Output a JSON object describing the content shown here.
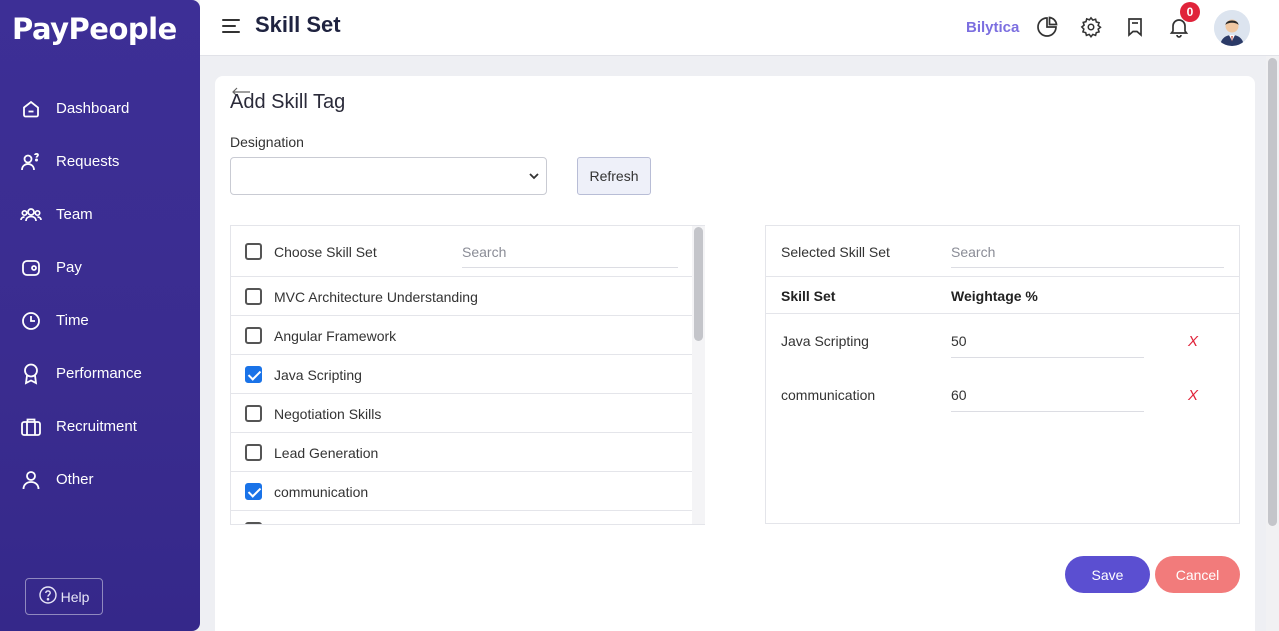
{
  "sidebar": {
    "logo": "PayPeople",
    "items": [
      {
        "label": "Dashboard",
        "icon": "home-icon"
      },
      {
        "label": "Requests",
        "icon": "user-question-icon"
      },
      {
        "label": "Team",
        "icon": "team-icon"
      },
      {
        "label": "Pay",
        "icon": "wallet-icon"
      },
      {
        "label": "Time",
        "icon": "clock-icon"
      },
      {
        "label": "Performance",
        "icon": "award-icon"
      },
      {
        "label": "Recruitment",
        "icon": "briefcase-icon"
      },
      {
        "label": "Other",
        "icon": "person-icon"
      }
    ],
    "help_label": "Help"
  },
  "header": {
    "title": "Skill Set",
    "brand_link": "Bilytica",
    "notification_count": "0"
  },
  "form": {
    "title": "Add Skill Tag",
    "designation_label": "Designation",
    "designation_value": "",
    "refresh_label": "Refresh"
  },
  "skill_list": {
    "header_label": "Choose Skill Set",
    "search_placeholder": "Search",
    "items": [
      {
        "label": "MVC Architecture Understanding",
        "checked": false
      },
      {
        "label": "Angular Framework",
        "checked": false
      },
      {
        "label": "Java Scripting",
        "checked": true
      },
      {
        "label": "Negotiation Skills",
        "checked": false
      },
      {
        "label": "Lead Generation",
        "checked": false
      },
      {
        "label": "communication",
        "checked": true
      },
      {
        "label": "",
        "checked": false
      }
    ]
  },
  "selected": {
    "title": "Selected Skill Set",
    "search_placeholder": "Search",
    "col_skill": "Skill Set",
    "col_weight": "Weightage %",
    "rows": [
      {
        "skill": "Java Scripting",
        "weight": "50",
        "remove": "X"
      },
      {
        "skill": "communication",
        "weight": "60",
        "remove": "X"
      }
    ]
  },
  "actions": {
    "save_label": "Save",
    "cancel_label": "Cancel"
  },
  "colors": {
    "sidebar": "#3a2c8f",
    "accent": "#5b4fd1",
    "cancel": "#f27b7b",
    "checkbox": "#1a73e8",
    "danger": "#e0233a"
  }
}
